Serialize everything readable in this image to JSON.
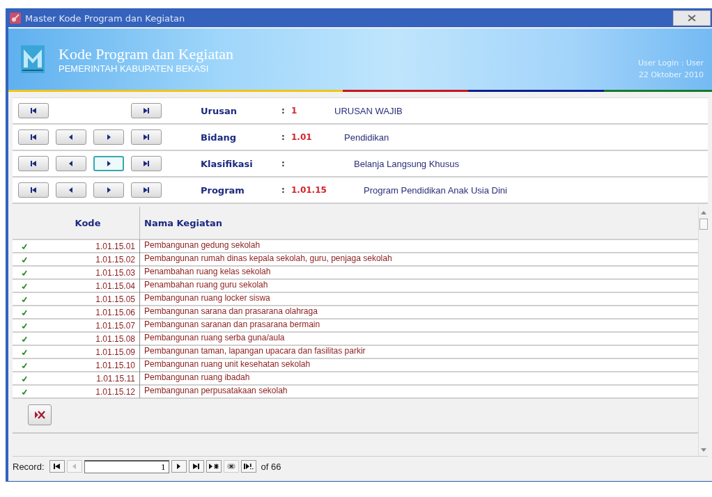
{
  "window": {
    "title": "Master Kode Program dan Kegiatan"
  },
  "header": {
    "title": "Kode Program dan Kegiatan",
    "subtitle": "PEMERINTAH  KABUPATEN  BEKASI",
    "user_login": "User Login :  User",
    "date": "22 Oktober 2010"
  },
  "nav_rows": [
    {
      "label": "Urusan",
      "colon": ":",
      "code": "1",
      "name": "URUSAN  WAJIB",
      "buttons": [
        {
          "kind": "first",
          "focused": false
        },
        {
          "kind": "last",
          "focused": false
        }
      ]
    },
    {
      "label": "Bidang",
      "colon": ":",
      "code": "1.01",
      "name": "Pendidikan",
      "buttons": [
        {
          "kind": "first",
          "focused": false
        },
        {
          "kind": "prev",
          "focused": false
        },
        {
          "kind": "next",
          "focused": false
        },
        {
          "kind": "last",
          "focused": false
        }
      ]
    },
    {
      "label": "Klasifikasi",
      "colon": ":",
      "name": "Belanja Langsung Khusus",
      "buttons": [
        {
          "kind": "first",
          "focused": false
        },
        {
          "kind": "prev",
          "focused": false
        },
        {
          "kind": "next",
          "focused": true
        },
        {
          "kind": "last",
          "focused": false
        }
      ]
    },
    {
      "label": "Program",
      "colon": ":",
      "code": "1.01.15",
      "name": "Program Pendidikan Anak Usia Dini",
      "buttons": [
        {
          "kind": "first",
          "focused": false
        },
        {
          "kind": "prev",
          "focused": false
        },
        {
          "kind": "next",
          "focused": false
        },
        {
          "kind": "last",
          "focused": false
        }
      ]
    }
  ],
  "table": {
    "columns": [
      "Kode",
      "Nama Kegiatan"
    ],
    "rows": [
      {
        "kode": "1.01.15.01",
        "nama": "Pembangunan gedung sekolah"
      },
      {
        "kode": "1.01.15.02",
        "nama": "Pembangunan rumah dinas kepala sekolah, guru, penjaga sekolah"
      },
      {
        "kode": "1.01.15.03",
        "nama": "Penambahan ruang kelas sekolah"
      },
      {
        "kode": "1.01.15.04",
        "nama": "Penambahan ruang guru sekolah"
      },
      {
        "kode": "1.01.15.05",
        "nama": "Pembangunan ruang locker siswa"
      },
      {
        "kode": "1.01.15.06",
        "nama": "Pembangunan sarana dan prasarana olahraga"
      },
      {
        "kode": "1.01.15.07",
        "nama": "Pembangunan saranan dan prasarana bermain"
      },
      {
        "kode": "1.01.15.08",
        "nama": "Pembangunan ruang serba guna/aula"
      },
      {
        "kode": "1.01.15.09",
        "nama": "Pembangunan taman, lapangan upacara dan fasilitas parkir"
      },
      {
        "kode": "1.01.15.10",
        "nama": "Pembangunan ruang unit kesehatan sekolah"
      },
      {
        "kode": "1.01.15.11",
        "nama": "Pembangunan ruang ibadah"
      },
      {
        "kode": "1.01.15.12",
        "nama": "Pembangunan perpusatakaan sekolah"
      }
    ]
  },
  "record_bar": {
    "label": "Record:",
    "current": "1",
    "total": "of 66",
    "buttons": [
      {
        "kind": "first",
        "disabled": false
      },
      {
        "kind": "prev",
        "disabled": true
      },
      {
        "kind": "field"
      },
      {
        "kind": "next",
        "disabled": false
      },
      {
        "kind": "last",
        "disabled": false
      },
      {
        "kind": "new",
        "disabled": false
      },
      {
        "kind": "delete",
        "disabled": true
      },
      {
        "kind": "filter",
        "disabled": false
      }
    ]
  }
}
